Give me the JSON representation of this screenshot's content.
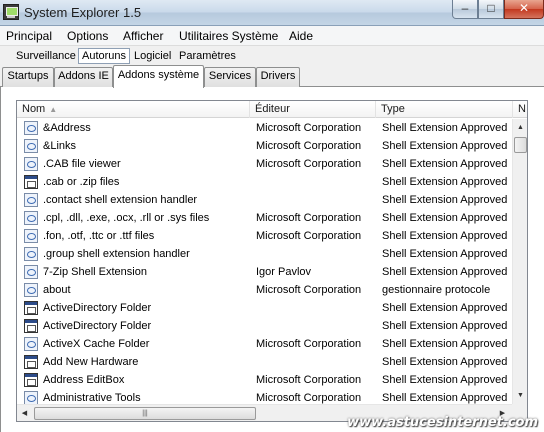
{
  "window": {
    "title": "System Explorer 1.5",
    "minimize": "–",
    "maximize": "□",
    "close": "✕"
  },
  "menu": [
    "Principal",
    "Options",
    "Afficher",
    "Utilitaires Système",
    "Aide"
  ],
  "subtabs": [
    "Surveillance",
    "Autoruns",
    "Logiciel",
    "Paramètres"
  ],
  "subtab_active": "Autoruns",
  "tabs": [
    "Startups",
    "Addons IE",
    "Addons système",
    "Services",
    "Drivers"
  ],
  "tab_active": "Addons système",
  "columns": {
    "name": "Nom",
    "editor": "Éditeur",
    "type": "Type",
    "overflow": "N"
  },
  "rows": [
    {
      "name": "&Address",
      "editor": "Microsoft Corporation",
      "type": "Shell Extension Approved",
      "icon": "doc-icon"
    },
    {
      "name": "&Links",
      "editor": "Microsoft Corporation",
      "type": "Shell Extension Approved",
      "icon": "doc-icon"
    },
    {
      "name": ".CAB file viewer",
      "editor": "Microsoft Corporation",
      "type": "Shell Extension Approved",
      "icon": "doc-icon"
    },
    {
      "name": ".cab or .zip files",
      "editor": "",
      "type": "Shell Extension Approved",
      "icon": "app-icon"
    },
    {
      "name": ".contact shell extension handler",
      "editor": "",
      "type": "Shell Extension Approved",
      "icon": "doc-icon"
    },
    {
      "name": ".cpl, .dll, .exe, .ocx, .rll or .sys files",
      "editor": "Microsoft Corporation",
      "type": "Shell Extension Approved",
      "icon": "doc-icon"
    },
    {
      "name": ".fon, .otf, .ttc or .ttf files",
      "editor": "Microsoft Corporation",
      "type": "Shell Extension Approved",
      "icon": "doc-icon"
    },
    {
      "name": ".group shell extension handler",
      "editor": "",
      "type": "Shell Extension Approved",
      "icon": "doc-icon"
    },
    {
      "name": "7-Zip Shell Extension",
      "editor": "Igor Pavlov",
      "type": "Shell Extension Approved",
      "icon": "doc-icon"
    },
    {
      "name": "about",
      "editor": "Microsoft Corporation",
      "type": "gestionnaire protocole",
      "icon": "doc-icon"
    },
    {
      "name": "ActiveDirectory Folder",
      "editor": "",
      "type": "Shell Extension Approved",
      "icon": "app-icon"
    },
    {
      "name": "ActiveDirectory Folder",
      "editor": "",
      "type": "Shell Extension Approved",
      "icon": "app-icon"
    },
    {
      "name": "ActiveX Cache Folder",
      "editor": "Microsoft Corporation",
      "type": "Shell Extension Approved",
      "icon": "doc-icon"
    },
    {
      "name": "Add New Hardware",
      "editor": "",
      "type": "Shell Extension Approved",
      "icon": "app-icon"
    },
    {
      "name": "Address EditBox",
      "editor": "Microsoft Corporation",
      "type": "Shell Extension Approved",
      "icon": "app-icon"
    },
    {
      "name": "Administrative Tools",
      "editor": "Microsoft Corporation",
      "type": "Shell Extension Approved",
      "icon": "doc-icon"
    }
  ],
  "watermark": "www.astucesinternet.com"
}
